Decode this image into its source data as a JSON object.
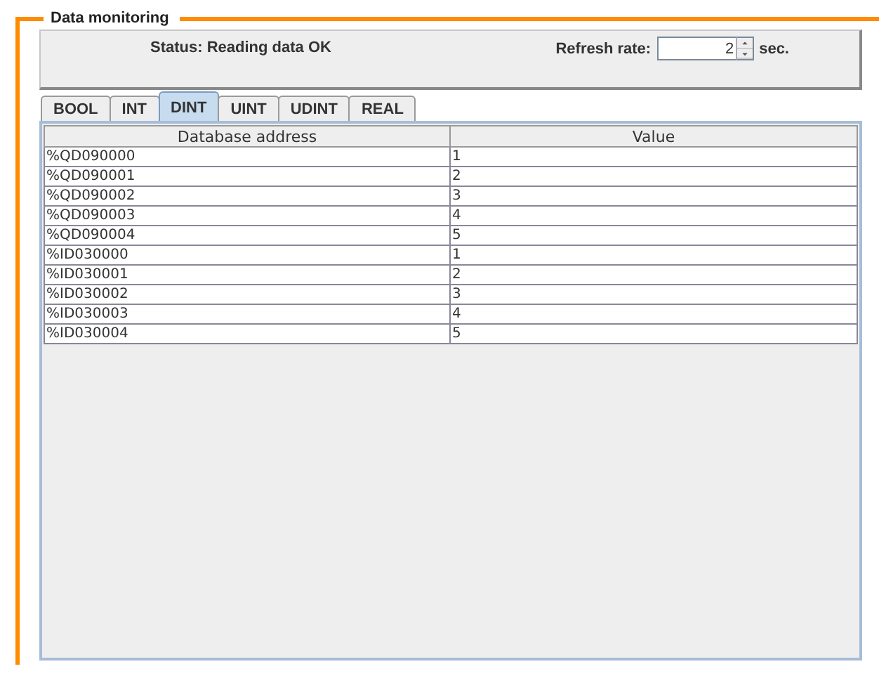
{
  "group": {
    "title": "Data monitoring"
  },
  "status": {
    "text": "Status: Reading data OK"
  },
  "refresh": {
    "label": "Refresh rate:",
    "value": "2",
    "unit": "sec."
  },
  "tabs": [
    {
      "label": "BOOL",
      "selected": false
    },
    {
      "label": "INT",
      "selected": false
    },
    {
      "label": "DINT",
      "selected": true
    },
    {
      "label": "UINT",
      "selected": false
    },
    {
      "label": "UDINT",
      "selected": false
    },
    {
      "label": "REAL",
      "selected": false
    }
  ],
  "table": {
    "columns": [
      "Database address",
      "Value"
    ],
    "rows": [
      [
        "%QD090000",
        "1"
      ],
      [
        "%QD090001",
        "2"
      ],
      [
        "%QD090002",
        "3"
      ],
      [
        "%QD090003",
        "4"
      ],
      [
        "%QD090004",
        "5"
      ],
      [
        "%ID030000",
        "1"
      ],
      [
        "%ID030001",
        "2"
      ],
      [
        "%ID030002",
        "3"
      ],
      [
        "%ID030003",
        "4"
      ],
      [
        "%ID030004",
        "5"
      ]
    ]
  }
}
